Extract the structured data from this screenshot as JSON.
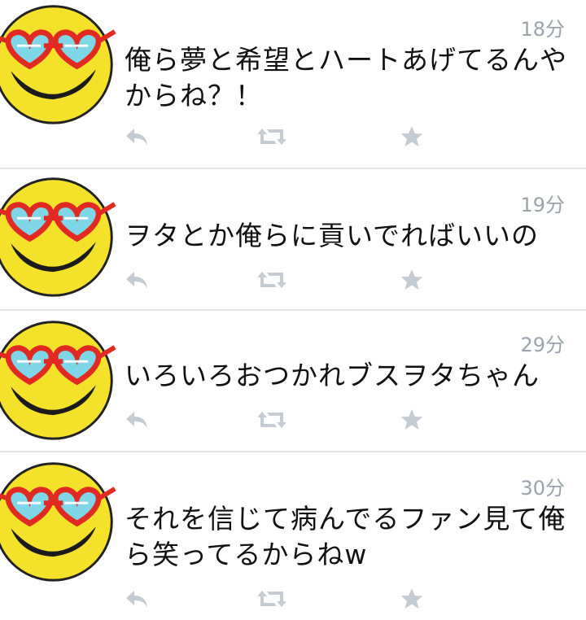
{
  "colors": {
    "text": "#111111",
    "timestamp": "#9aa3ab",
    "action_icon": "#c5ccd3",
    "divider": "#e3e3e3",
    "avatar_face": "#f4e22a",
    "avatar_glasses": "#e02a22",
    "avatar_lens": "#7fd6e6"
  },
  "icons": {
    "reply": "reply-icon",
    "retweet": "retweet-icon",
    "favorite": "star-icon"
  },
  "tweets": [
    {
      "time": "18分",
      "text": "俺ら夢と希望とハートあげてるんやからね？！"
    },
    {
      "time": "19分",
      "text": "ヲタとか俺らに貢いでればいいの"
    },
    {
      "time": "29分",
      "text": "いろいろおつかれブスヲタちゃん"
    },
    {
      "time": "30分",
      "text": "それを信じて病んでるファン見て俺ら笑ってるからねw"
    }
  ]
}
